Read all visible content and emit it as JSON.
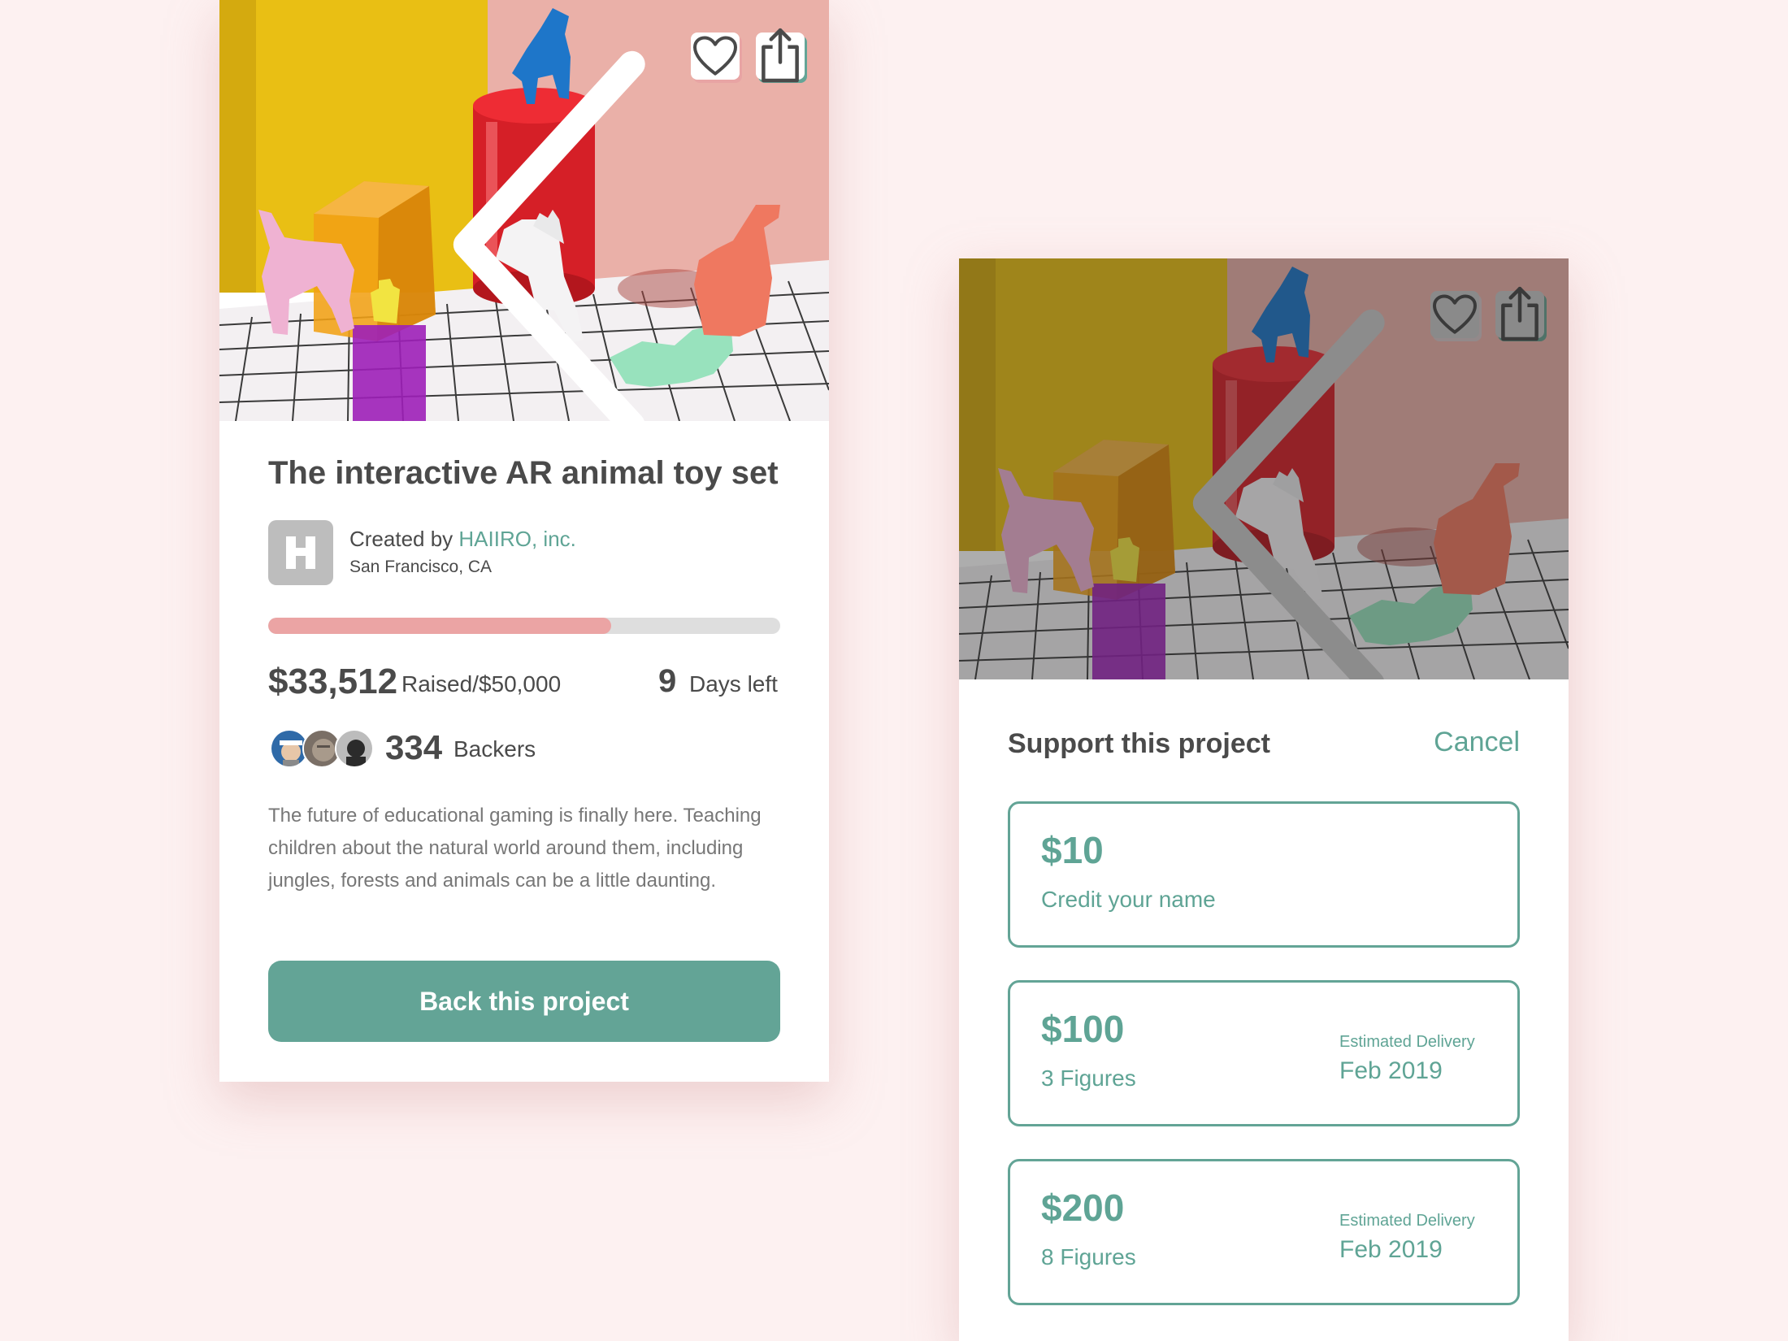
{
  "colors": {
    "accent": "#63a496",
    "accent_text": "#5fa495",
    "progress": "#eba4a4",
    "background": "#fdf1f1",
    "text": "#4a4a4a"
  },
  "detail": {
    "title": "The interactive AR animal toy set",
    "creator_prefix": "Created by ",
    "creator_name": "HAIIRO, inc.",
    "creator_location": "San Francisco, CA",
    "creator_logo_icon": "h-logo-icon",
    "progress_fraction": 0.6702,
    "raised_amount": "$33,512",
    "raised_goal": "Raised/$50,000",
    "days_left_number": "9",
    "days_left_label": "Days left",
    "backers_count": "334",
    "backers_label": "Backers",
    "description": "The future of educational gaming is finally here. Teaching children about the natural world around them, including jungles, forests and animals can be a little daunting.",
    "cta_label": "Back this project",
    "icons": [
      "chevron-left-icon",
      "heart-icon",
      "share-icon"
    ]
  },
  "support": {
    "title": "Support this project",
    "cancel_label": "Cancel",
    "tiers": [
      {
        "amount": "$10",
        "description": "Credit your name",
        "delivery_label": "",
        "delivery_date": ""
      },
      {
        "amount": "$100",
        "description": "3 Figures",
        "delivery_label": "Estimated Delivery",
        "delivery_date": "Feb 2019"
      },
      {
        "amount": "$200",
        "description": "8 Figures",
        "delivery_label": "Estimated Delivery",
        "delivery_date": "Feb 2019"
      }
    ]
  }
}
